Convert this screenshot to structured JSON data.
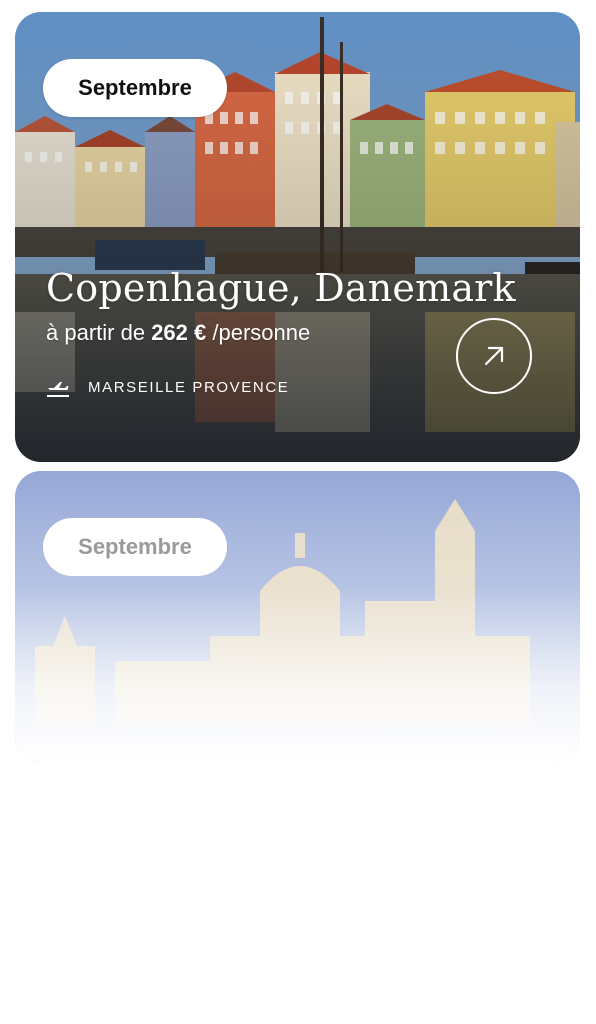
{
  "cards": [
    {
      "month": "Septembre",
      "destination": "Copenhague, Danemark",
      "price_prefix": "à partir de",
      "price": "262 €",
      "price_suffix": "/personne",
      "departure_airport": "MARSEILLE PROVENCE",
      "plane_icon": "plane-departure-icon",
      "arrow_icon": "arrow-up-right-icon",
      "image_subject": "Nyhavn colorful harbor houses"
    },
    {
      "month": "Septembre",
      "image_subject": "Palermo cathedral skyline"
    }
  ],
  "colors": {
    "text_on_image": "#ffffff",
    "pill_bg": "#ffffff",
    "pill_text": "#111111",
    "page_bg": "#ffffff"
  }
}
